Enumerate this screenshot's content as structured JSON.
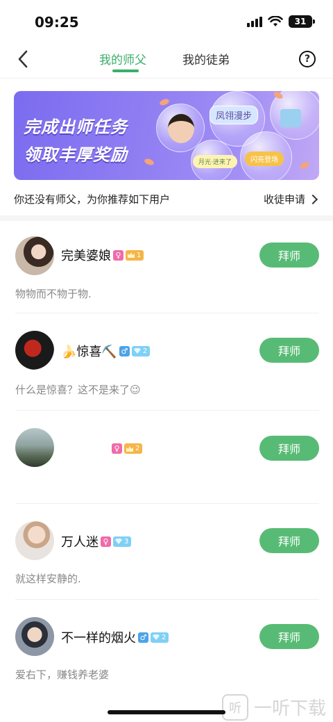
{
  "status_bar": {
    "time": "09:25",
    "battery": "31"
  },
  "nav": {
    "tabs": [
      {
        "label": "我的师父",
        "active": true
      },
      {
        "label": "我的徒弟",
        "active": false
      }
    ],
    "help_label": "?"
  },
  "banner": {
    "title_line1": "完成出师任务",
    "title_line2": "领取丰厚奖励",
    "tag_fengxiang": "凤翎漫步",
    "tag_youlai": "月光·进来了",
    "tag_shanliang": "闪亮登场"
  },
  "info": {
    "text": "你还没有师父，为你推荐如下用户",
    "apply_label": "收徒申请"
  },
  "accent_color": "#58bb75",
  "tab_active_color": "#3bae6a",
  "users": [
    {
      "name": "完美婆娘",
      "gender_icon": "female-icon",
      "gender": "♀",
      "level_type": "gold",
      "level": "1",
      "bio": "物物而不物于物.",
      "button": "拜师"
    },
    {
      "name": "🍌惊喜⛏️",
      "gender_icon": "male-icon",
      "gender": "♂",
      "level_type": "blue",
      "level": "2",
      "bio": "什么是惊喜？这不是来了😉",
      "button": "拜师"
    },
    {
      "name": "",
      "gender_icon": "female-icon",
      "gender": "♀",
      "level_type": "gold",
      "level": "2",
      "bio": "",
      "button": "拜师"
    },
    {
      "name": "万人迷",
      "gender_icon": "female-icon",
      "gender": "♀",
      "level_type": "blue",
      "level": "3",
      "bio": "就这样安静的.",
      "button": "拜师"
    },
    {
      "name": "不一样的烟火",
      "gender_icon": "male-icon",
      "gender": "♂",
      "level_type": "blue",
      "level": "2",
      "bio": "爱右下，赚钱养老婆",
      "button": "拜师"
    }
  ],
  "watermark": {
    "logo": "听",
    "text": "一听下载"
  }
}
